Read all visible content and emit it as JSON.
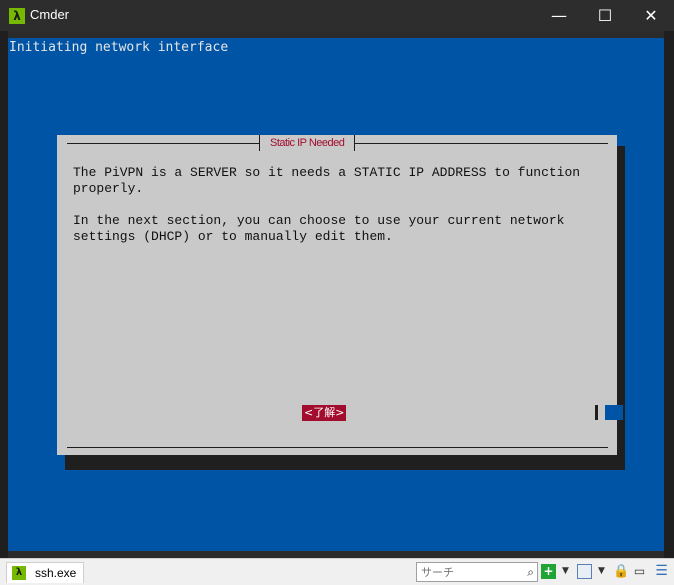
{
  "window": {
    "title": "Cmder",
    "app_icon": "λ",
    "controls": {
      "minimize": "—",
      "maximize": "☐",
      "close": "✕"
    }
  },
  "terminal": {
    "line1": "Initiating network interface"
  },
  "dialog": {
    "title": "Static IP Needed",
    "body": "The PiVPN is a SERVER so it needs a STATIC IP ADDRESS to function\nproperly.\n\nIn the next section, you can choose to use your current network\nsettings (DHCP) or to manually edit them.",
    "ok_button": "<了解>"
  },
  "statusbar": {
    "tab_label": "ssh.exe",
    "tab_icon": "λ",
    "search_placeholder": "サーチ",
    "icons": [
      "search-icon",
      "add-console-icon",
      "split-view-icon",
      "lock-icon",
      "console-icon",
      "menu-icon"
    ]
  },
  "colors": {
    "terminal_bg": "#0054a6",
    "dialog_bg": "#c9c9c9",
    "accent_red": "#a20d2d"
  }
}
